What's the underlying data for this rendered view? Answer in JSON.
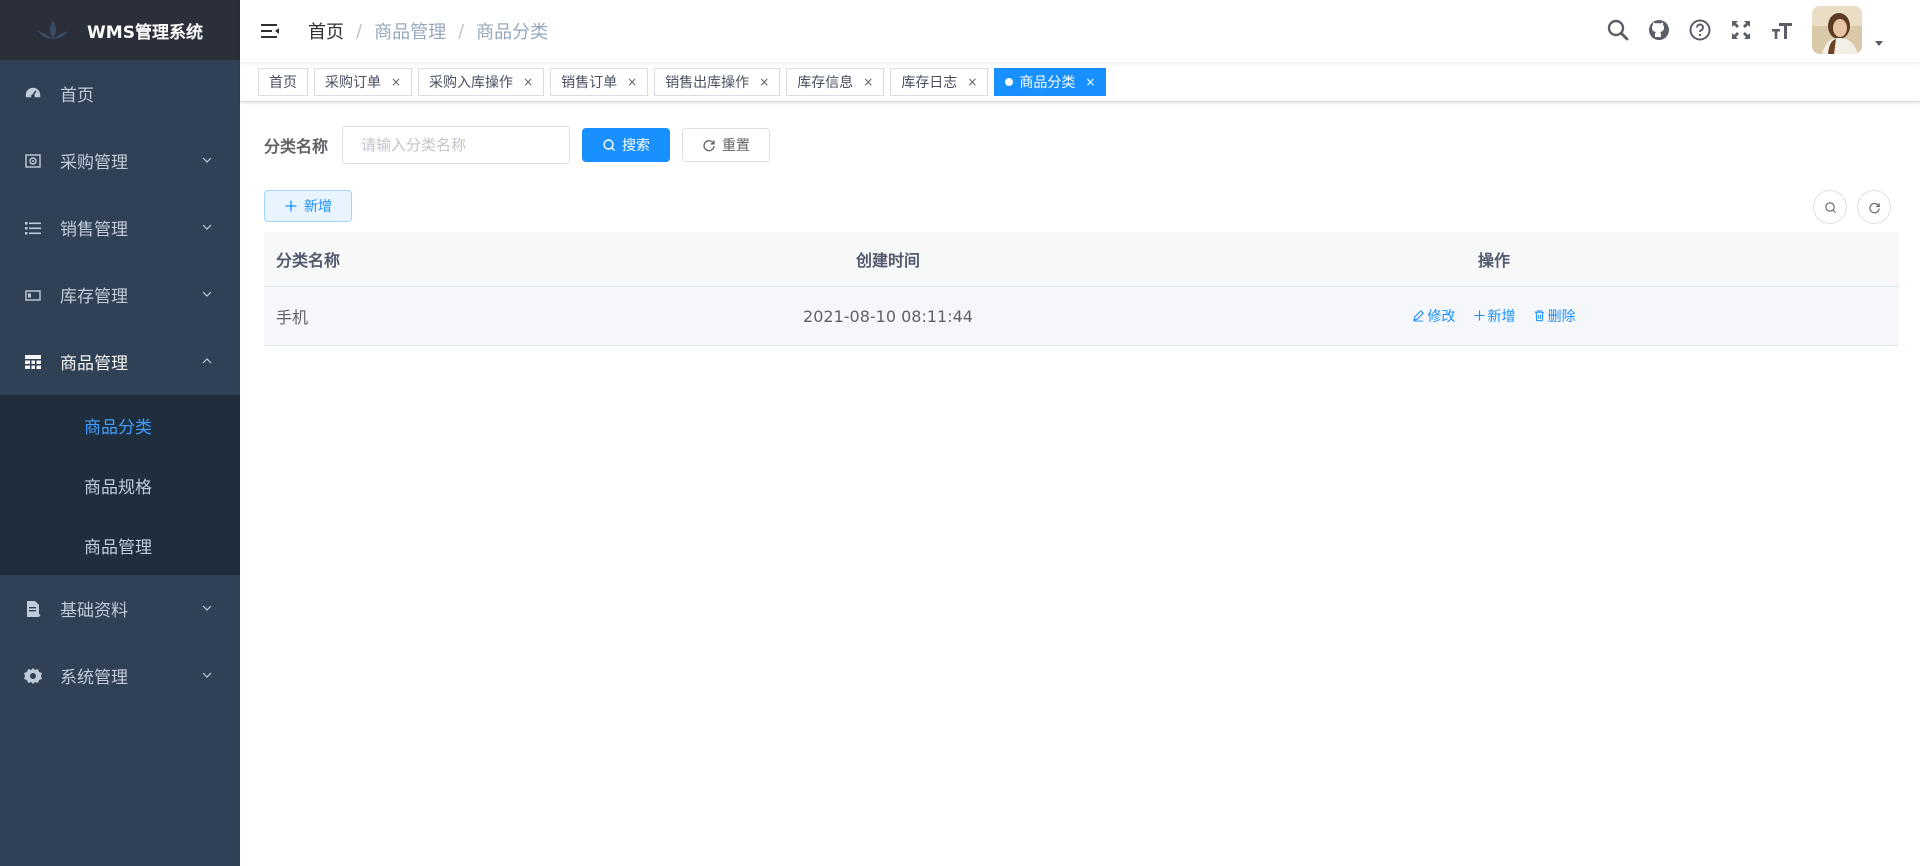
{
  "app": {
    "title": "WMS管理系统"
  },
  "sidebar": {
    "items": [
      {
        "label": "首页",
        "icon": "dashboard-icon"
      },
      {
        "label": "采购管理",
        "icon": "purchase-icon"
      },
      {
        "label": "销售管理",
        "icon": "list-icon"
      },
      {
        "label": "库存管理",
        "icon": "stock-icon"
      },
      {
        "label": "商品管理",
        "icon": "table-icon"
      },
      {
        "label": "基础资料",
        "icon": "document-icon"
      },
      {
        "label": "系统管理",
        "icon": "gear-icon"
      }
    ],
    "submenu": [
      {
        "label": "商品分类",
        "active": true
      },
      {
        "label": "商品规格"
      },
      {
        "label": "商品管理"
      }
    ]
  },
  "header": {
    "breadcrumb": [
      "首页",
      "商品管理",
      "商品分类"
    ],
    "separator": "/"
  },
  "tags": [
    {
      "label": "首页"
    },
    {
      "label": "采购订单"
    },
    {
      "label": "采购入库操作"
    },
    {
      "label": "销售订单"
    },
    {
      "label": "销售出库操作"
    },
    {
      "label": "库存信息"
    },
    {
      "label": "库存日志"
    },
    {
      "label": "商品分类",
      "active": true
    }
  ],
  "tag_close": "×",
  "search": {
    "label": "分类名称",
    "placeholder": "请输入分类名称",
    "search_button": "搜索",
    "reset_button": "重置"
  },
  "toolbar": {
    "add_button": "新增"
  },
  "table": {
    "columns": [
      "分类名称",
      "创建时间",
      "操作"
    ],
    "rows": [
      {
        "name": "手机",
        "created": "2021-08-10 08:11:44"
      }
    ],
    "actions": {
      "edit": "修改",
      "add": "新增",
      "delete": "删除"
    }
  },
  "colors": {
    "sidebar_bg": "#304156",
    "submenu_bg": "#1f2d3d",
    "accent": "#1890ff",
    "active_submenu": "#409eff"
  }
}
